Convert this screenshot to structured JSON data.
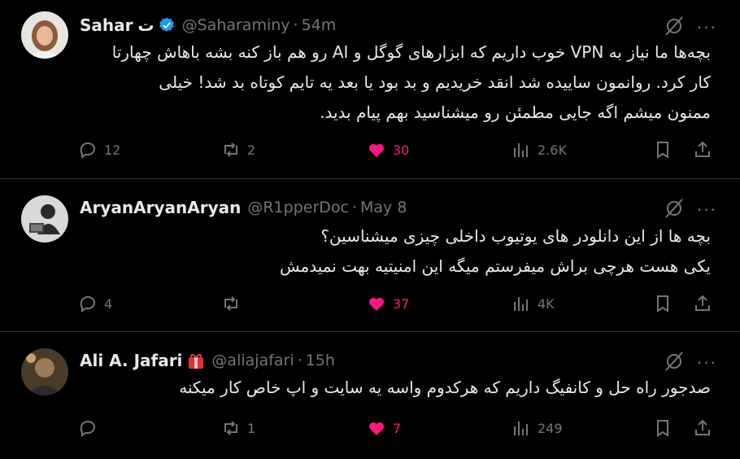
{
  "tweets": [
    {
      "name": "Sahar",
      "name_extra": "ت",
      "verified": true,
      "handle": "@Saharaminy",
      "separator": "·",
      "time": "54m",
      "lines": [
        "بچه‌ها ما نیاز به VPN خوب داریم که ابزارهای گوگل و AI رو هم باز کنه بشه باهاش چهارتا",
        "کار کرد. روانمون ساییده شد انقد خریدیم و بد بود یا بعد یه تایم کوتاه بد شد! خیلی",
        "ممنون میشم اگه جایی مطمئن رو میشناسید بهم پیام بدید."
      ],
      "replies": "12",
      "reposts": "2",
      "likes": "30",
      "views": "2.6K"
    },
    {
      "name": "AryanAryanAryan",
      "handle": "@R1pperDoc",
      "separator": "·",
      "time": "May 8",
      "lines": [
        "بچه ها از این دانلودر های یوتیوب داخلی چیزی میشناسین؟",
        "یکی هست هرچی براش میفرستم میگه این امنیتیه بهت نمیدمش"
      ],
      "replies": "4",
      "reposts": "",
      "likes": "37",
      "views": "4K"
    },
    {
      "name": "Ali A. Jafari",
      "badge_icon": "red-gift-badge-icon",
      "handle": "@aliajafari",
      "separator": "·",
      "time": "15h",
      "lines": [
        "صدجور راه حل و کانفیگ داریم که هرکدوم واسه یه سایت و اپ خاص کار میکنه"
      ],
      "replies": "",
      "reposts": "1",
      "likes": "7",
      "views": "249"
    }
  ],
  "more_label": "···",
  "colors": {
    "background": "#000000",
    "text": "#e7e9ea",
    "muted": "#71767b",
    "like": "#f91880",
    "verified": "#1d9bf0",
    "divider": "#2f3336"
  }
}
